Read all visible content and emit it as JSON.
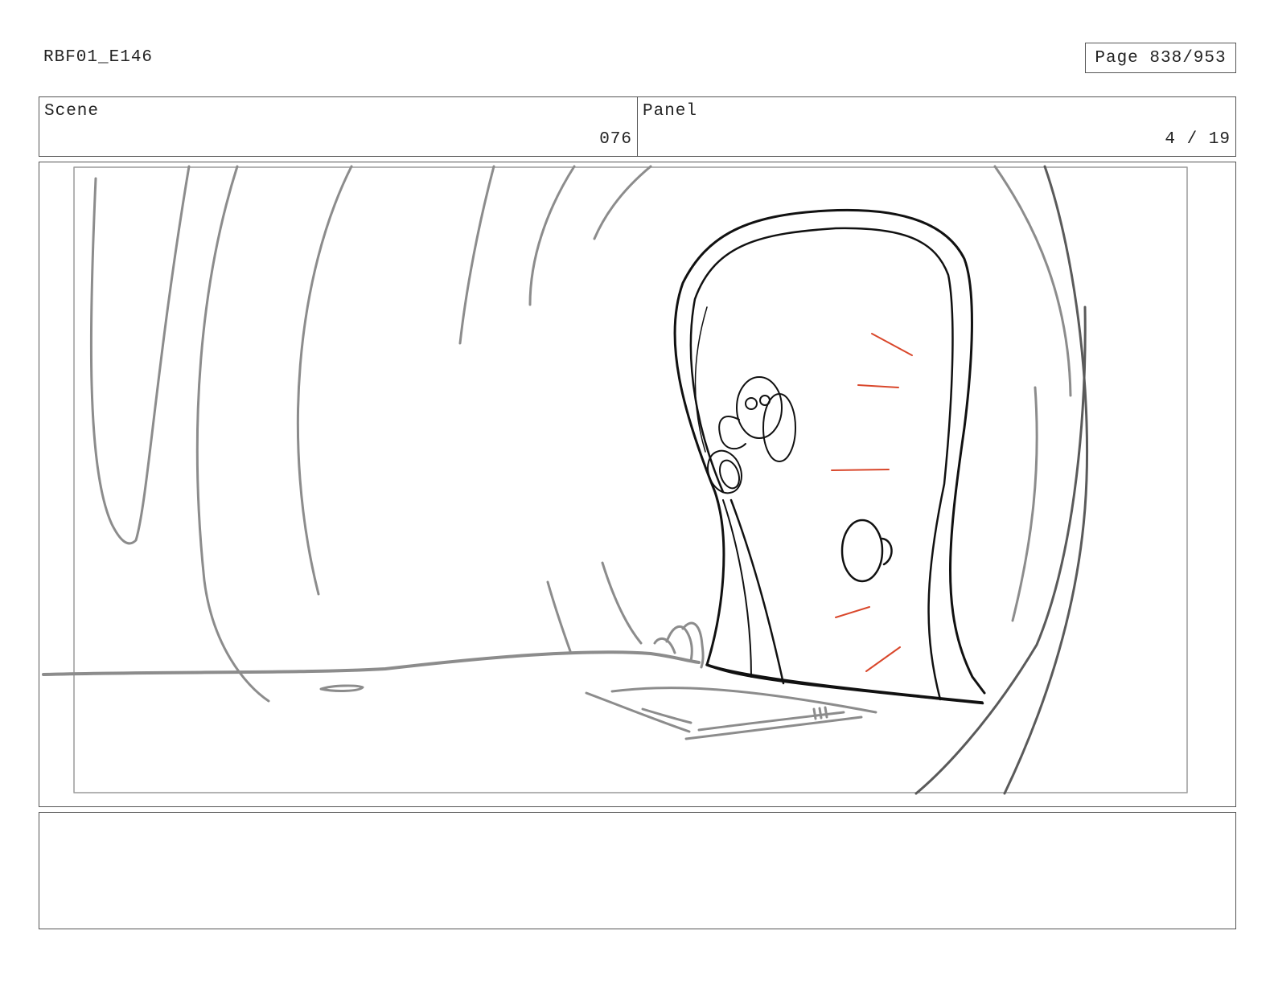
{
  "header": {
    "document_id": "RBF01_E146",
    "page": "Page 838/953"
  },
  "scene": {
    "label": "Scene",
    "value": "076"
  },
  "panel": {
    "label": "Panel",
    "value": "4 / 19"
  },
  "colors": {
    "sketch_gray": "#8c8c8c",
    "sketch_dark": "#5a5a5a",
    "ink_black": "#111111",
    "action_red": "#d9472b",
    "border": "#555555"
  },
  "notes": {
    "text": ""
  }
}
